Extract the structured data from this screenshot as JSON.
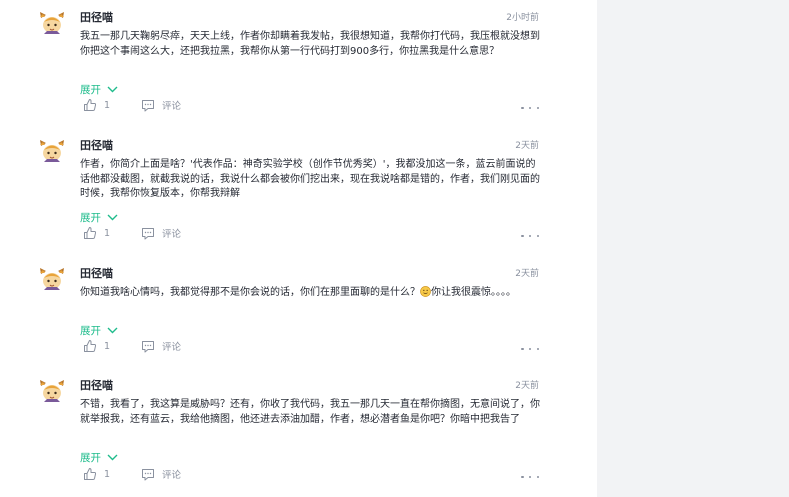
{
  "comments": [
    {
      "author": "田径喵",
      "time": "2小时前",
      "text": "我五一那几天鞠躬尽瘁，天天上线，作者你却瞒着我发帖，我很想知道，我帮你打代码，我压根就没想到你把这个事闹这么大，还把我拉黑，我帮你从第一行代码打到900多行，你拉黑我是什么意思？",
      "expand_label": "展开",
      "likes": "1",
      "reply_label": "评论"
    },
    {
      "author": "田径喵",
      "time": "2天前",
      "text": "作者，你简介上面是啥？'代表作品：神奇实验学校（创作节优秀奖）'，我都没加这一条，蓝云前面说的话他都没截图，就截我说的话，我说什么都会被你们挖出来，现在我说啥都是错的，作者，我们刚见面的时候，我帮你恢复版本，你帮我辩解",
      "expand_label": "展开",
      "likes": "1",
      "reply_label": "评论"
    },
    {
      "author": "田径喵",
      "time": "2天前",
      "text_before": "你知道我啥心情吗，我都觉得那不是你会说的话，你们在那里面聊的是什么？",
      "emoji": "smile-emoji",
      "text_after": "你让我很震惊。。。。",
      "expand_label": "展开",
      "likes": "1",
      "reply_label": "评论"
    },
    {
      "author": "田径喵",
      "time": "2天前",
      "text": "不错，我看了，我这算是威胁吗？还有，你收了我代码，我五一那几天一直在帮你摘图，无意间说了，你就举报我，还有蓝云，我给他摘图，他还进去添油加醋，作者，想必潜者鱼是你吧？你暗中把我告了",
      "expand_label": "展开",
      "likes": "1",
      "reply_label": "评论"
    }
  ],
  "colors": {
    "accent": "#1fbc8c",
    "muted": "#8a919f",
    "text": "#252933",
    "panel": "#f2f3f5"
  }
}
